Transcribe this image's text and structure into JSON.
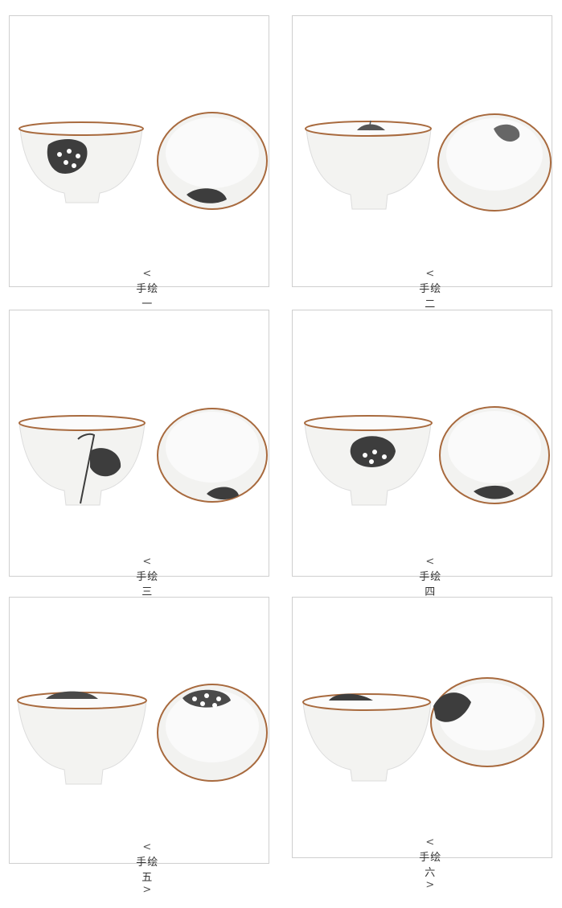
{
  "items": [
    {
      "left": "<",
      "label": "手绘",
      "num": "一",
      "right": ">",
      "style": "pod-side"
    },
    {
      "left": "<",
      "label": "手绘",
      "num": "二",
      "right": ">",
      "style": "stem-rim"
    },
    {
      "left": "<",
      "label": "手绘",
      "num": "三",
      "right": ">",
      "style": "hanging-pod"
    },
    {
      "left": "<",
      "label": "手绘",
      "num": "四",
      "right": ">",
      "style": "pod-front"
    },
    {
      "left": "<",
      "label": "手绘",
      "num": "五",
      "right": ">",
      "style": "pod-inside"
    },
    {
      "left": "<",
      "label": "手绘",
      "num": "六",
      "right": ">",
      "style": "leaf-rim"
    }
  ],
  "colors": {
    "rim": "#a86a3e",
    "ink": "#3a3a3a",
    "glaze": "#f4f4f2",
    "border": "#cfcfcf"
  }
}
